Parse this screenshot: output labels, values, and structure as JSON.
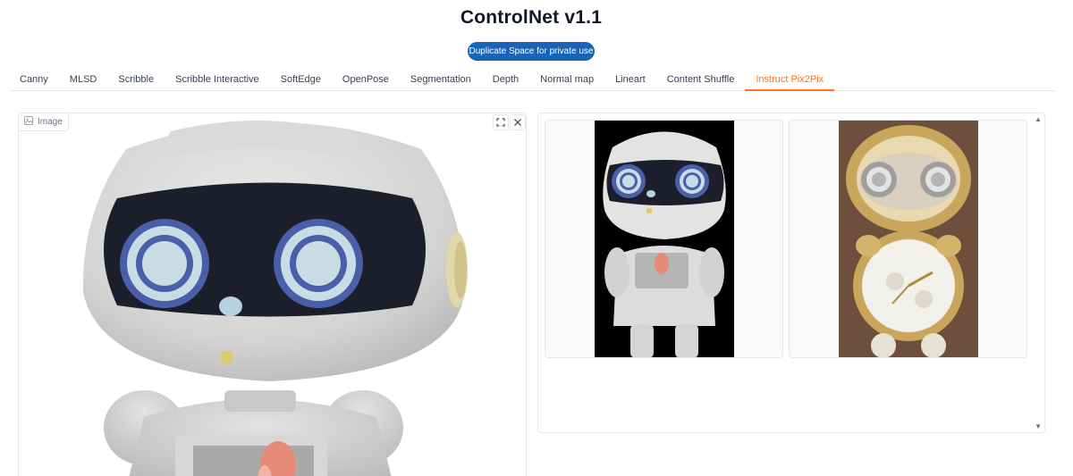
{
  "app": {
    "title": "ControlNet v1.1",
    "duplicate_label": "Duplicate Space for private use"
  },
  "tabs": [
    {
      "label": "Canny"
    },
    {
      "label": "MLSD"
    },
    {
      "label": "Scribble"
    },
    {
      "label": "Scribble Interactive"
    },
    {
      "label": "SoftEdge"
    },
    {
      "label": "OpenPose"
    },
    {
      "label": "Segmentation"
    },
    {
      "label": "Depth"
    },
    {
      "label": "Normal map"
    },
    {
      "label": "Lineart"
    },
    {
      "label": "Content Shuffle"
    },
    {
      "label": "Instruct Pix2Pix"
    }
  ],
  "active_tab": "Instruct Pix2Pix",
  "input_image": {
    "label": "Image",
    "icons": [
      "image-icon",
      "fullscreen-icon",
      "close-icon"
    ]
  },
  "gallery": {
    "icons": [
      "scroll-up-icon",
      "scroll-down-icon"
    ]
  },
  "colors": {
    "accent": "#f97316",
    "button": "#1764b8"
  }
}
